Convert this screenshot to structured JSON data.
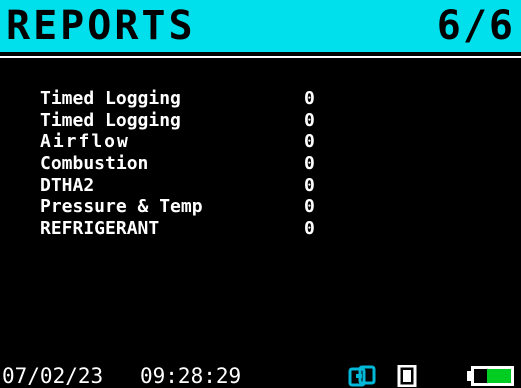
{
  "header": {
    "title": "REPORTS",
    "page": "6/6"
  },
  "reports": [
    {
      "name": "Timed Logging",
      "count": "0"
    },
    {
      "name": "Timed Logging",
      "count": "0"
    },
    {
      "name": "Airflow",
      "count": "0"
    },
    {
      "name": "Combustion",
      "count": "0"
    },
    {
      "name": "DTHA2",
      "count": "0"
    },
    {
      "name": "Pressure & Temp",
      "count": "0"
    },
    {
      "name": "REFRIGERANT",
      "count": "0"
    }
  ],
  "status": {
    "date": "07/02/23",
    "time": "09:28:29",
    "icons": [
      "link-icon",
      "memory-card-icon",
      "battery-icon"
    ],
    "battery_level": 0.65
  },
  "colors": {
    "header_bg": "#00e0ec",
    "battery_fill": "#00cc22",
    "link_icon": "#00b8d8"
  }
}
